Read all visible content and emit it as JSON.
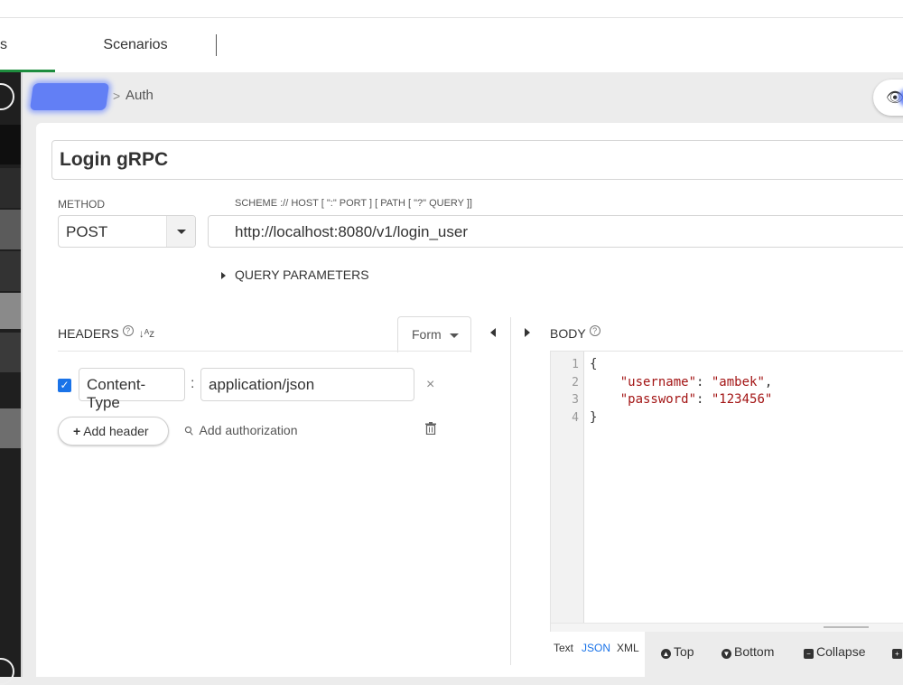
{
  "tabs": {
    "left_partial": "s",
    "scenarios": "Scenarios"
  },
  "breadcrumb": {
    "separator": ">",
    "current": "Auth"
  },
  "request": {
    "name": "Login gRPC",
    "method_label": "METHOD",
    "method": "POST",
    "url_label": "SCHEME :// HOST [ \":\" PORT ] [ PATH [ \"?\" QUERY ]]",
    "url": "http://localhost:8080/v1/login_user",
    "query_params_label": "QUERY PARAMETERS"
  },
  "headers": {
    "title": "HEADERS",
    "mode": "Form",
    "items": [
      {
        "enabled": true,
        "key": "Content-Type",
        "value": "application/json"
      }
    ],
    "add_header": "Add header",
    "add_authorization": "Add authorization"
  },
  "body": {
    "title": "BODY",
    "line_numbers": [
      "1",
      "2",
      "3",
      "4"
    ],
    "lines": {
      "l1": "{",
      "l2_key": "\"username\"",
      "l2_val": "\"ambek\"",
      "l3_key": "\"password\"",
      "l3_val": "\"123456\"",
      "l4": "}"
    },
    "formats": [
      "Text",
      "JSON",
      "XML"
    ],
    "active_format": "JSON",
    "tools": [
      "Top",
      "Bottom",
      "Collapse"
    ]
  },
  "colors": {
    "accent_green": "#1e8d3e",
    "checkbox_blue": "#1a73e8",
    "json_string": "#a31515"
  }
}
